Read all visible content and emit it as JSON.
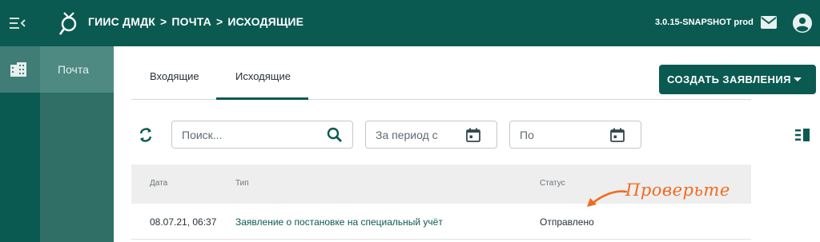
{
  "header": {
    "breadcrumb": [
      "ГИИС ДМДК",
      "ПОЧТА",
      "ИСХОДЯЩИЕ"
    ],
    "separator": ">",
    "version": "3.0.15-SNAPSHOT prod",
    "icons": [
      "menu-toggle-icon",
      "logo-ring-icon",
      "mail-icon",
      "account-circle-icon"
    ]
  },
  "sidebar": {
    "rail_icon": "building-icon",
    "items": [
      {
        "label": "Почта"
      }
    ]
  },
  "tabs": [
    {
      "label": "Входящие",
      "active": false
    },
    {
      "label": "Исходящие",
      "active": true
    }
  ],
  "actions": {
    "create_label": "СОЗДАТЬ ЗАЯВЛЕНИЯ"
  },
  "filters": {
    "search_placeholder": "Поиск...",
    "date_from_placeholder": "За период с",
    "date_to_placeholder": "По"
  },
  "table": {
    "columns": [
      "Дата",
      "Тип",
      "Статус"
    ],
    "rows": [
      {
        "date": "08.07.21, 06:37",
        "type": "Заявление о постановке на специальный учёт",
        "status": "Отправлено"
      }
    ]
  },
  "annotation": {
    "text": "Проверьте"
  },
  "colors": {
    "primary": "#0b5a52",
    "sidebar": "#2f6f66",
    "annotation": "#f06a1f"
  }
}
